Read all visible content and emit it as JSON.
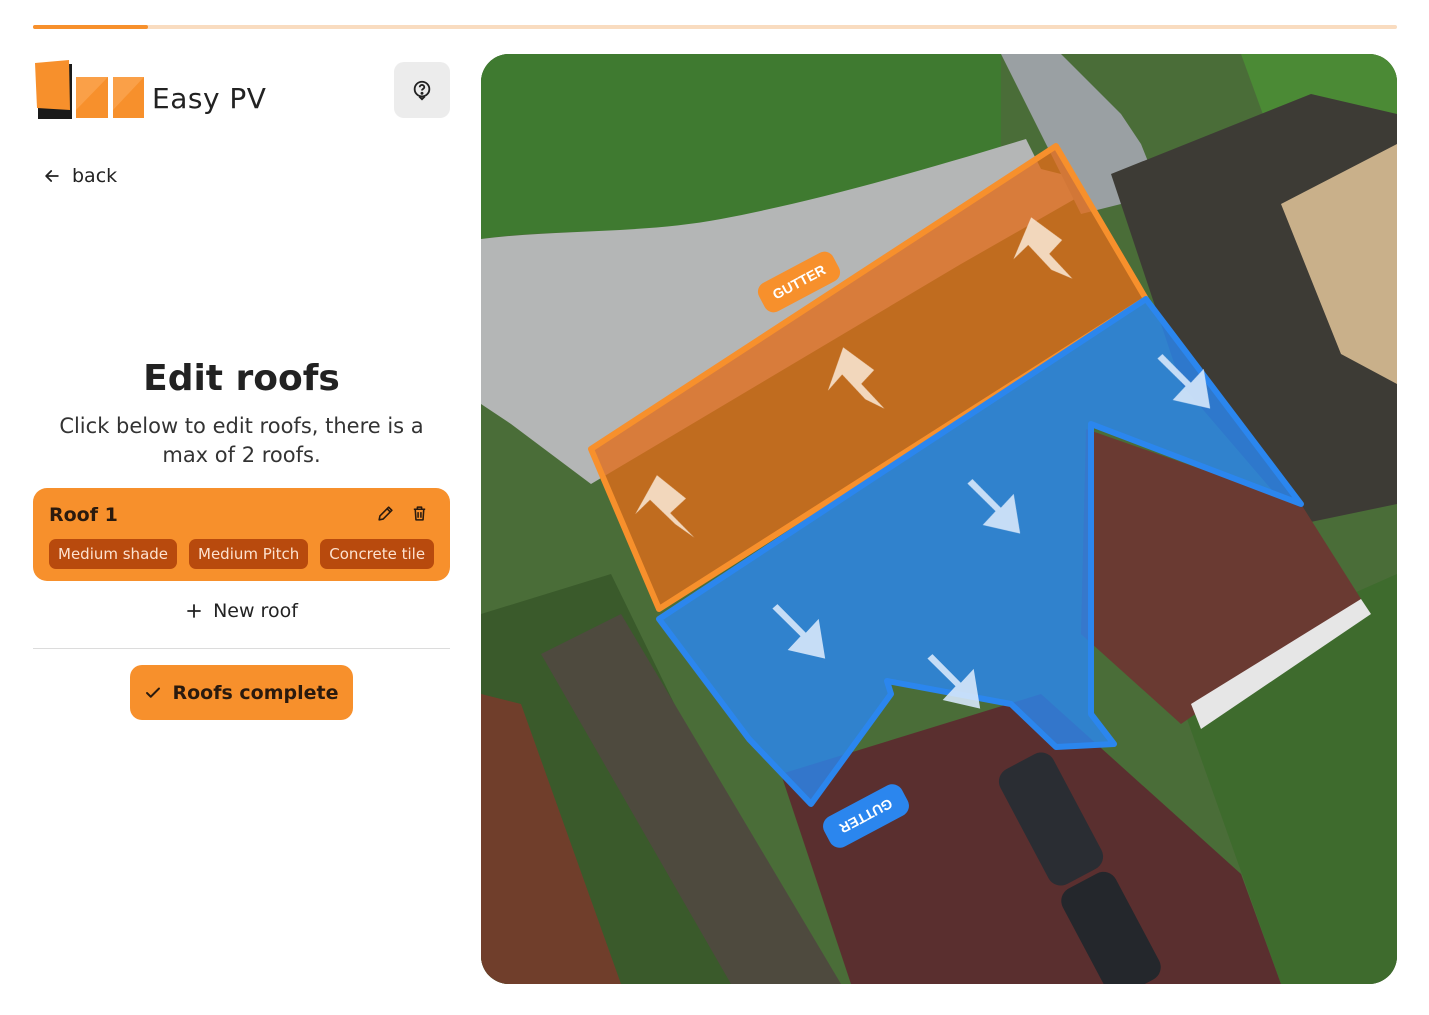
{
  "progress": {
    "fraction": 0.084
  },
  "brand": {
    "name": "Easy PV",
    "color": "#f7902c"
  },
  "header": {
    "help_icon": "help-circle-icon"
  },
  "nav": {
    "back_label": "back",
    "back_icon": "arrow-left-icon"
  },
  "main": {
    "title": "Edit roofs",
    "subtitle": "Click below to edit roofs, there is a max of 2 roofs."
  },
  "roofs": [
    {
      "name": "Roof 1",
      "edit_icon": "pencil-icon",
      "delete_icon": "trash-icon",
      "tags": [
        "Medium shade",
        "Medium Pitch",
        "Concrete tile"
      ]
    }
  ],
  "actions": {
    "new_roof_label": "New roof",
    "new_roof_icon": "plus-icon",
    "complete_label": "Roofs complete",
    "complete_icon": "check-icon"
  },
  "map": {
    "gutter_label_1": "GUTTER",
    "gutter_label_2": "GUTTER",
    "roof1_color": "#f07d22",
    "roof2_color": "#2b86ee"
  }
}
